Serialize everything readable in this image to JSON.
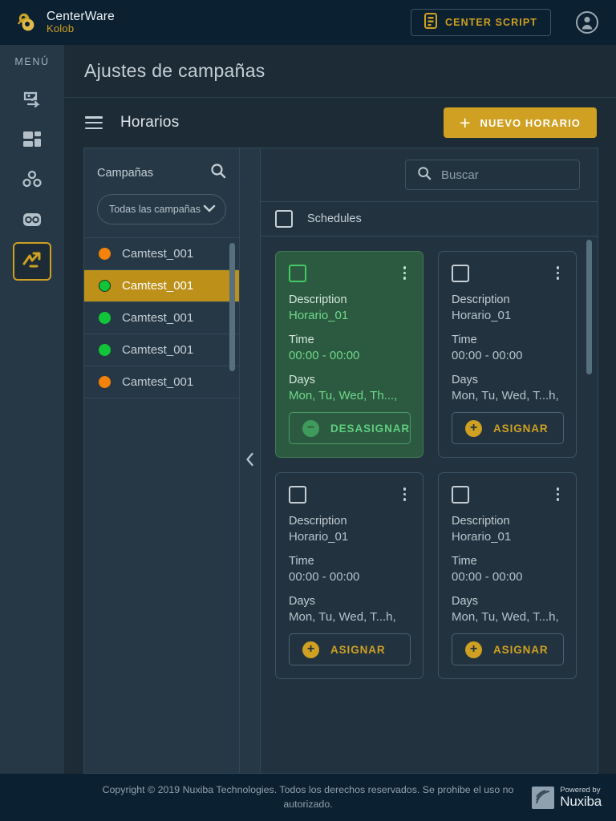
{
  "topbar": {
    "brand_name": "CenterWare",
    "brand_sub": "Kolob",
    "center_script_label": "CENTER SCRIPT",
    "center_script_icon": "script-document-icon",
    "avatar_icon": "user-account-icon",
    "accent_color": "#cfa021",
    "background": "#0b2031"
  },
  "sidebar": {
    "title": "MENÚ",
    "items": [
      {
        "icon": "transfer-exchange-icon",
        "active": false
      },
      {
        "icon": "dashboard-grid-icon",
        "active": false
      },
      {
        "icon": "group-nodes-icon",
        "active": false
      },
      {
        "icon": "voicemail-icon",
        "active": false
      },
      {
        "icon": "activity-trend-icon",
        "active": true
      }
    ]
  },
  "page": {
    "title": "Ajustes de campañas"
  },
  "section": {
    "menu_icon": "hamburger-menu-icon",
    "title": "Horarios",
    "new_button_label": "NUEVO HORARIO",
    "new_button_icon": "plus-icon"
  },
  "campaigns_panel": {
    "title": "Campañas",
    "search_icon": "search-icon",
    "filter_value": "Todas las campañas",
    "filter_icon": "chevron-down-icon",
    "items": [
      {
        "name": "Camtest_001",
        "status_color": "#f2820a",
        "selected": false
      },
      {
        "name": "Camtest_001",
        "status_color": "#12c43a",
        "selected": true
      },
      {
        "name": "Camtest_001",
        "status_color": "#12c43a",
        "selected": false
      },
      {
        "name": "Camtest_001",
        "status_color": "#12c43a",
        "selected": false
      },
      {
        "name": "Camtest_001",
        "status_color": "#f2820a",
        "selected": false
      }
    ]
  },
  "collapse": {
    "icon": "chevron-left-icon"
  },
  "schedules_panel": {
    "search": {
      "placeholder": "Buscar",
      "value": "",
      "icon": "search-icon"
    },
    "select_all_label": "Schedules",
    "select_all_checked": false,
    "field_labels": {
      "description": "Description",
      "time": "Time",
      "days": "Days"
    },
    "cards": [
      {
        "description": "Horario_01",
        "time": "00:00 - 00:00",
        "days": "Mon, Tu, Wed, Th...,",
        "assigned": true,
        "button_label": "DESASIGNAR",
        "button_icon": "minus-circle-icon",
        "checked": false,
        "menu_icon": "kebab-menu-icon"
      },
      {
        "description": "Horario_01",
        "time": "00:00 - 00:00",
        "days": "Mon, Tu, Wed, T...h,",
        "assigned": false,
        "button_label": "ASIGNAR",
        "button_icon": "plus-circle-icon",
        "checked": false,
        "menu_icon": "kebab-menu-icon"
      },
      {
        "description": "Horario_01",
        "time": "00:00 - 00:00",
        "days": "Mon, Tu, Wed, T...h,",
        "assigned": false,
        "button_label": "ASIGNAR",
        "button_icon": "plus-circle-icon",
        "checked": false,
        "menu_icon": "kebab-menu-icon"
      },
      {
        "description": "Horario_01",
        "time": "00:00 - 00:00",
        "days": "Mon, Tu, Wed, T...h,",
        "assigned": false,
        "button_label": "ASIGNAR",
        "button_icon": "plus-circle-icon",
        "checked": false,
        "menu_icon": "kebab-menu-icon"
      }
    ]
  },
  "footer": {
    "copyright": "Copyright © 2019 Nuxiba Technologies. Todos los derechos reservados. Se prohibe el uso no autorizado.",
    "powered_label": "Powered by",
    "powered_name": "Nuxiba"
  }
}
